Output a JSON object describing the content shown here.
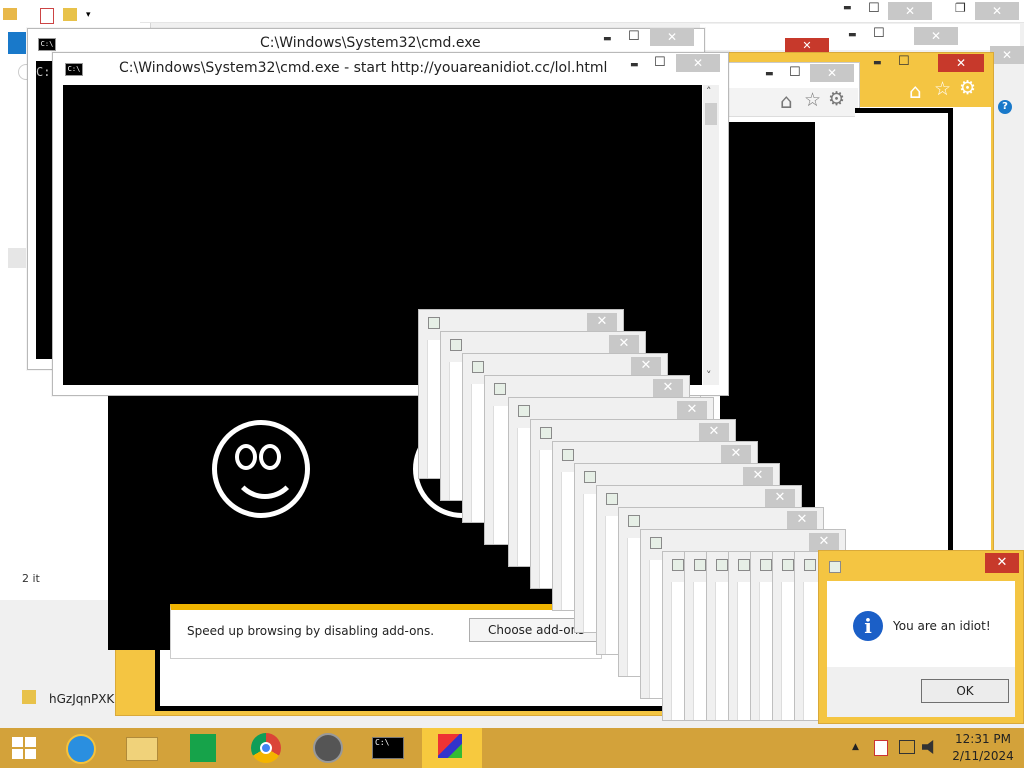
{
  "explorer": {
    "items_label": "2 it",
    "file_name": "hGzJqnPXK"
  },
  "cmd_back": {
    "title": "C:\\Windows\\System32\\cmd.exe",
    "prompt": "C:"
  },
  "cmd_front": {
    "title": "C:\\Windows\\System32\\cmd.exe - start  http://youareanidiot.cc/lol.html"
  },
  "addons_bar": {
    "message": "Speed up browsing by disabling add-ons.",
    "button": "Choose add-ons"
  },
  "dialog": {
    "message": "You are an idiot!",
    "ok_label": "OK"
  },
  "taskbar": {
    "time": "12:31 PM",
    "date": "2/11/2024"
  },
  "symbols": {
    "close": "✕",
    "minimize": "▬",
    "maximize": "☐",
    "restore": "❐",
    "home": "⌂",
    "star": "☆",
    "gear": "⚙",
    "help": "?",
    "up_arrow": "˄",
    "down_arrow": "˅",
    "chevron": "▲",
    "info": "i",
    "tiles": "⊞",
    "cmd": "C:\\"
  },
  "colors": {
    "ie_frame": "#f4c542",
    "close_red": "#c7392b",
    "taskbar": "#d3a23a",
    "taskbar_active": "#f7c93e"
  }
}
